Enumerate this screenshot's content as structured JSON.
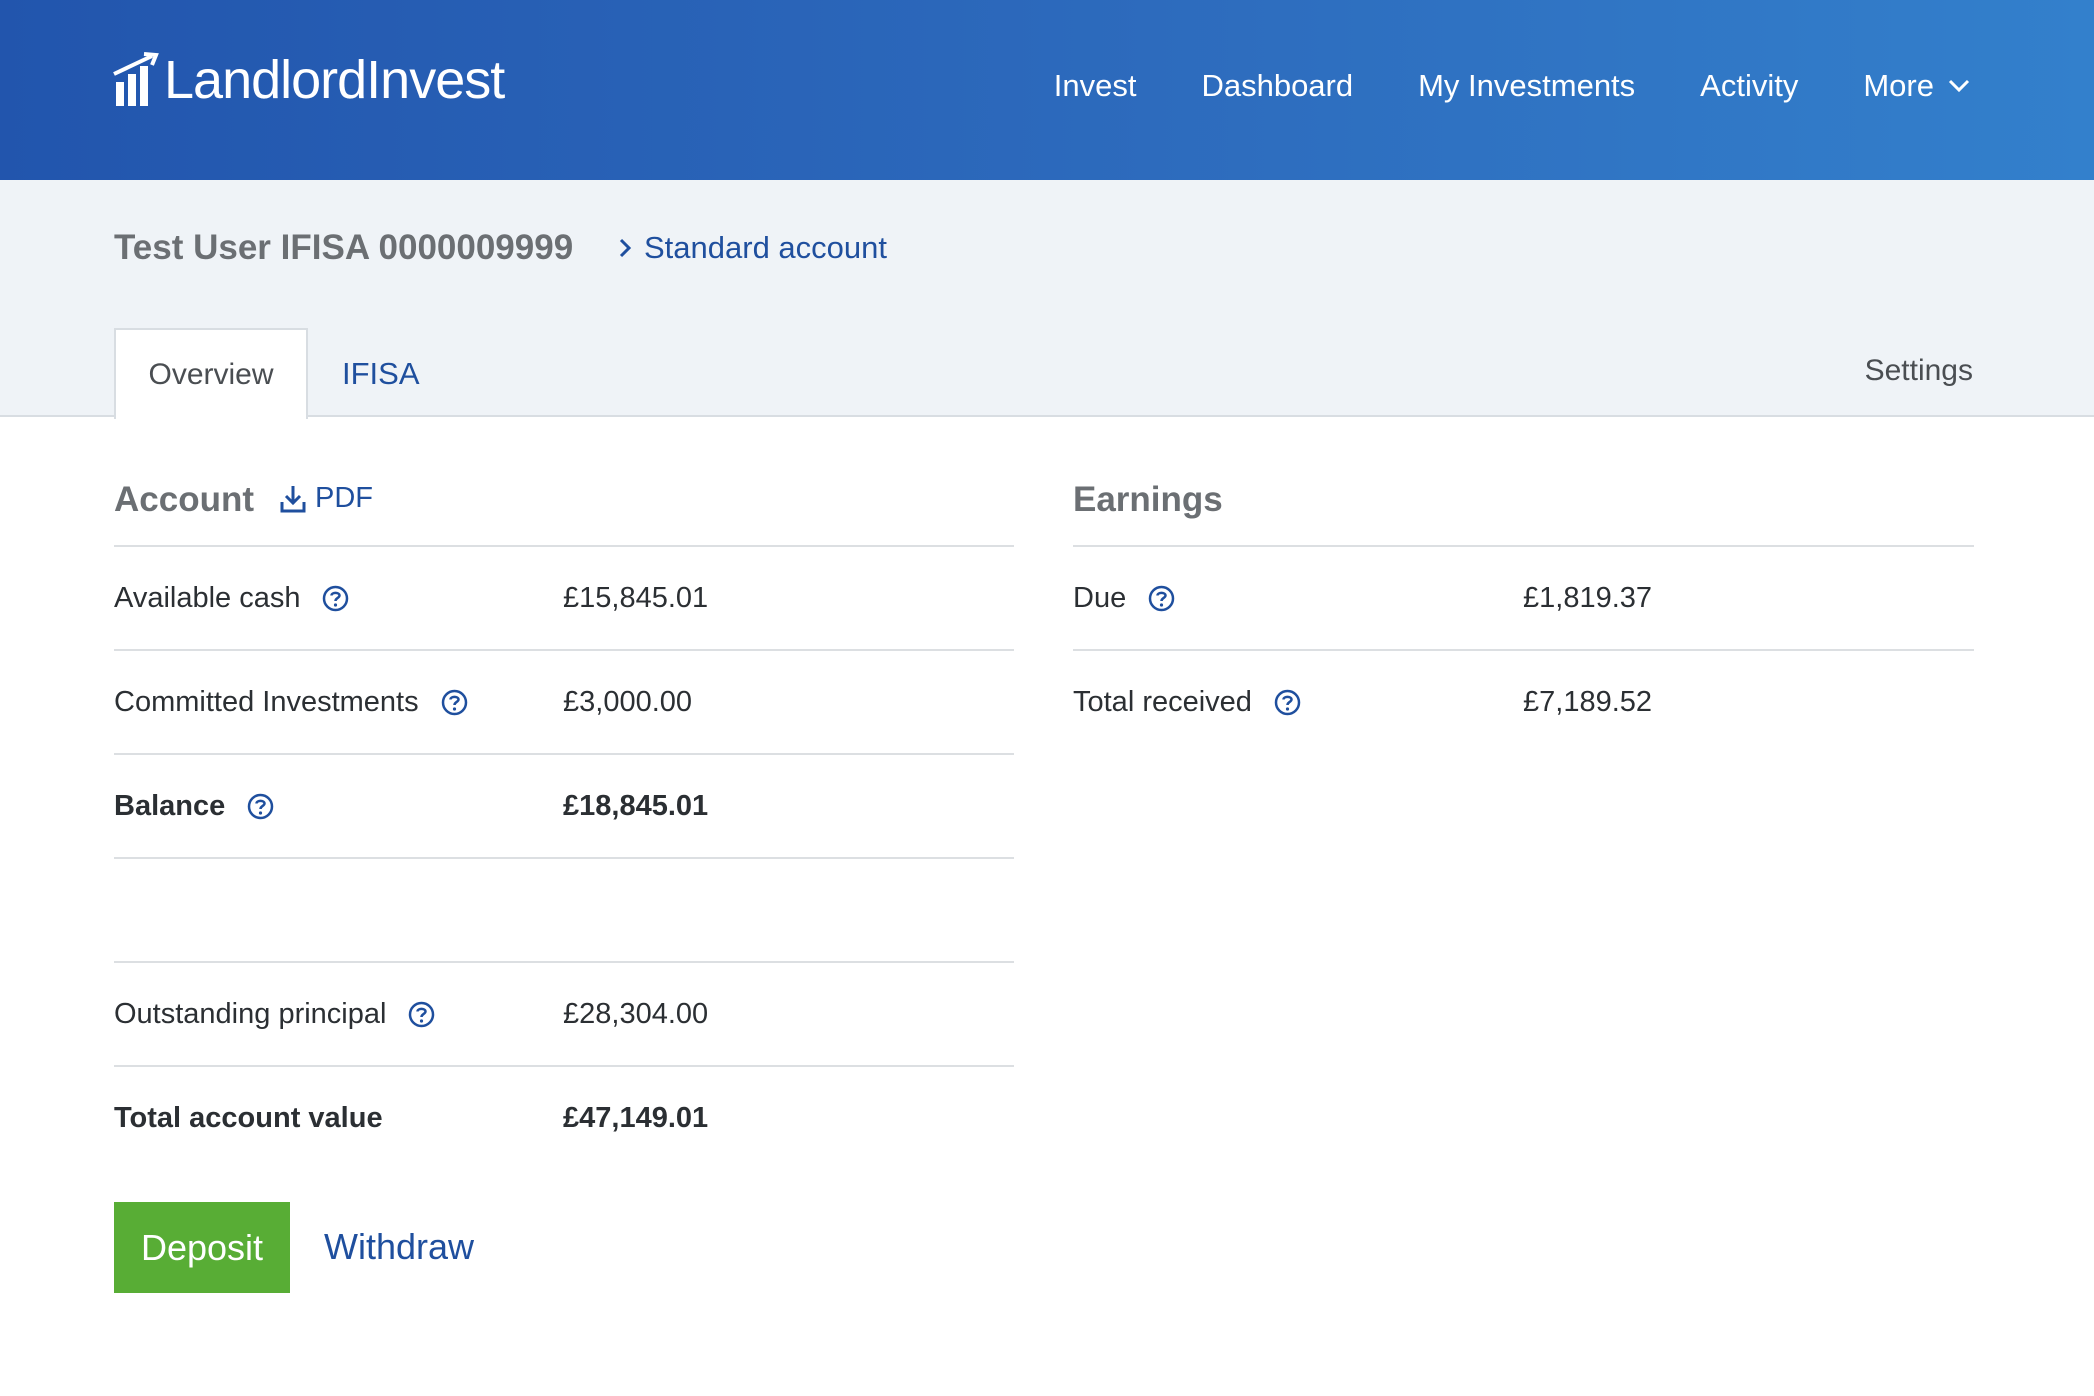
{
  "header": {
    "logo_text": "LandlordInvest",
    "nav": [
      "Invest",
      "Dashboard",
      "My Investments",
      "Activity",
      "More"
    ]
  },
  "account": {
    "name": "Test User IFISA 0000009999",
    "switch_link": "Standard account"
  },
  "tabs": {
    "overview": "Overview",
    "ifisa": "IFISA",
    "settings": "Settings"
  },
  "account_section": {
    "title": "Account",
    "pdf_label": "PDF",
    "rows": [
      {
        "label": "Available cash",
        "value": "£15,845.01"
      },
      {
        "label": "Committed Investments",
        "value": "£3,000.00"
      },
      {
        "label": "Balance",
        "value": "£18,845.01"
      },
      {
        "label": "Outstanding principal",
        "value": "£28,304.00"
      },
      {
        "label": "Total account value",
        "value": "£47,149.01"
      }
    ]
  },
  "earnings_section": {
    "title": "Earnings",
    "rows": [
      {
        "label": "Due",
        "value": "£1,819.37"
      },
      {
        "label": "Total received",
        "value": "£7,189.52"
      }
    ]
  },
  "actions": {
    "deposit": "Deposit",
    "withdraw": "Withdraw"
  },
  "colors": {
    "header_blue": "#2a62b6",
    "link_blue": "#1f4f9e",
    "deposit_green": "#58ad35"
  },
  "icons": {
    "logo": "bar-chart-icon",
    "more": "chevron-down-icon",
    "standard_account": "chevron-right-icon",
    "pdf": "download-icon",
    "help": "help-circle-icon"
  }
}
